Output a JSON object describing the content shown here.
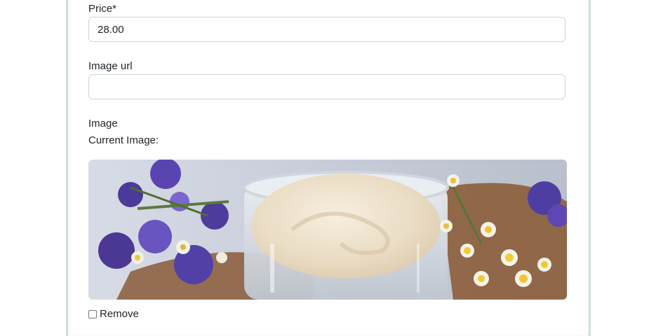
{
  "form": {
    "price": {
      "label": "Price*",
      "value": "28.00"
    },
    "image_url": {
      "label": "Image url",
      "value": ""
    },
    "image": {
      "label": "Image",
      "current_label": "Current Image:",
      "remove_label": "Remove",
      "remove_checked": false
    }
  },
  "colors": {
    "card_border": "#cfe0da",
    "input_border": "#ced4da",
    "text": "#212529"
  }
}
